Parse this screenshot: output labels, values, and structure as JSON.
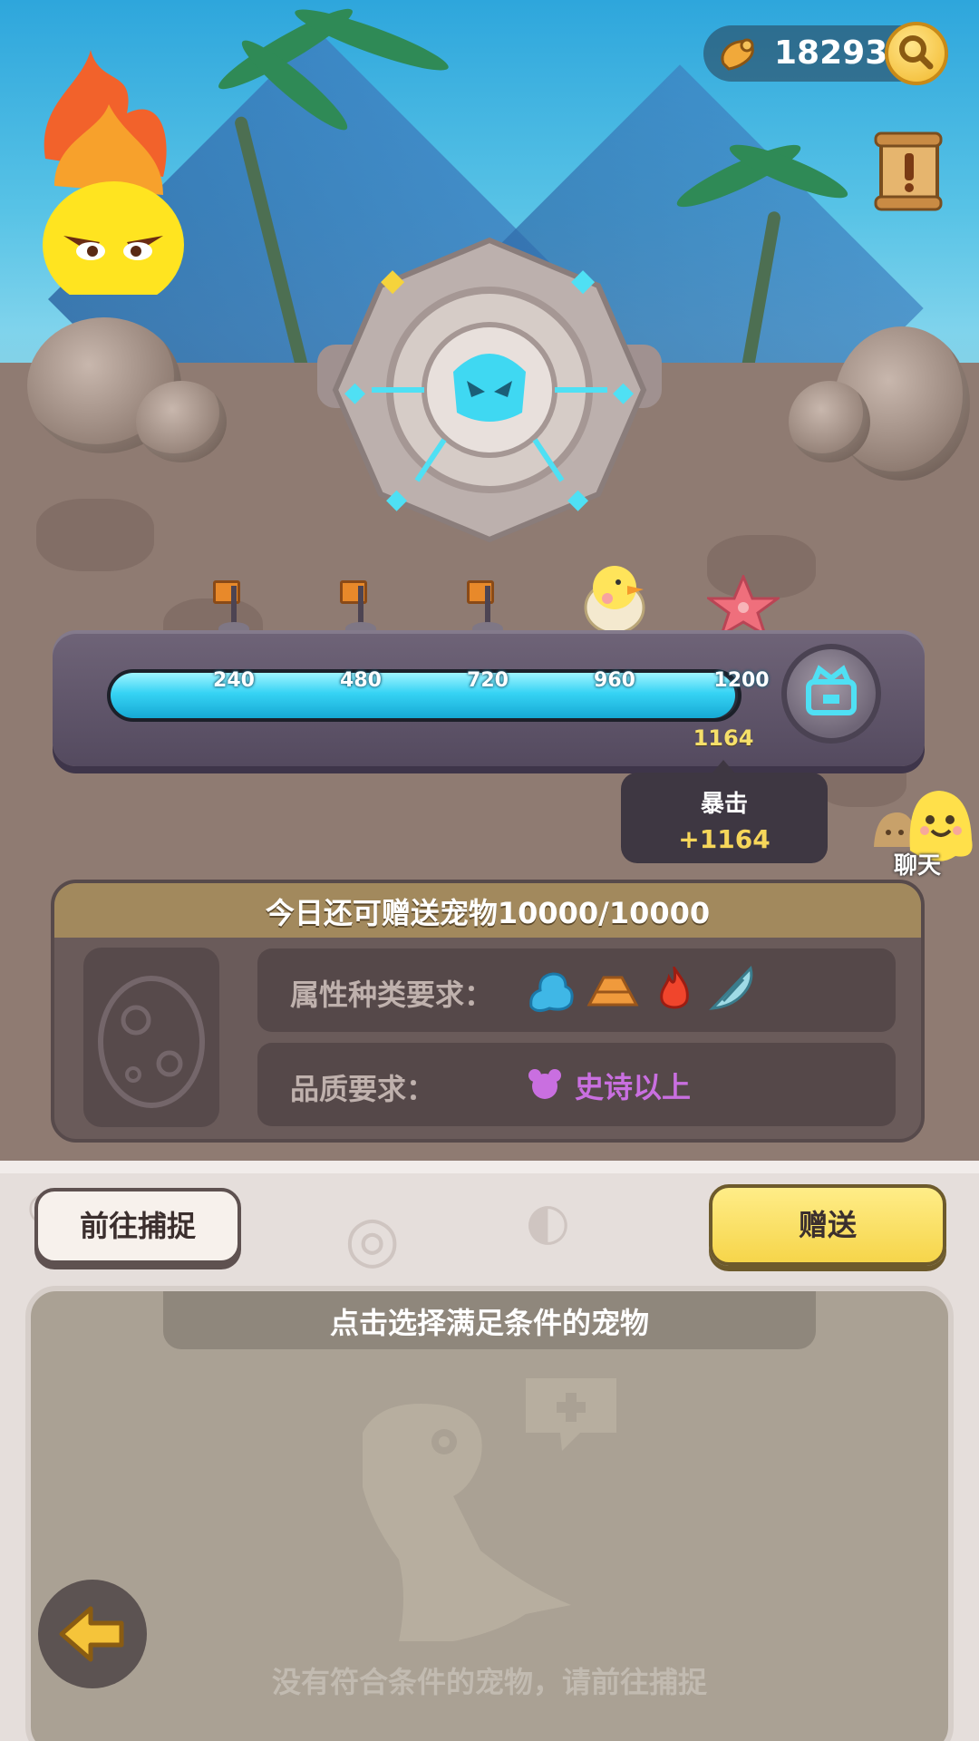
{
  "currency": {
    "amount": "18293",
    "icon": "bone-icon"
  },
  "progress": {
    "milestones": [
      "240",
      "480",
      "720",
      "960",
      "1200"
    ],
    "max": 1200,
    "current": 1164,
    "current_label": "1164",
    "rewards": [
      "flag-icon",
      "flag-icon",
      "flag-icon",
      "chick-egg-icon",
      "starfish-icon"
    ]
  },
  "crit_tip": {
    "title": "暴击",
    "value": "+1164"
  },
  "chat": {
    "label": "聊天"
  },
  "panel": {
    "title": "今日还可赠送宠物10000/10000",
    "attr_label": "属性种类要求：",
    "attr_icons": [
      "water-icon",
      "earth-icon",
      "fire-icon",
      "wind-icon"
    ],
    "quality_label": "品质要求：",
    "quality_value": "史诗以上",
    "quality_color": "#c96fe0"
  },
  "buttons": {
    "goto_capture": "前往捕捉",
    "gift": "赠送"
  },
  "pet_area": {
    "title": "点击选择满足条件的宠物",
    "empty_text": "没有符合条件的宠物，请前往捕捉"
  },
  "colors": {
    "accent_yellow": "#f6d54a",
    "bar_cyan": "#36d3f4",
    "crit_gold": "#f6d65a"
  }
}
